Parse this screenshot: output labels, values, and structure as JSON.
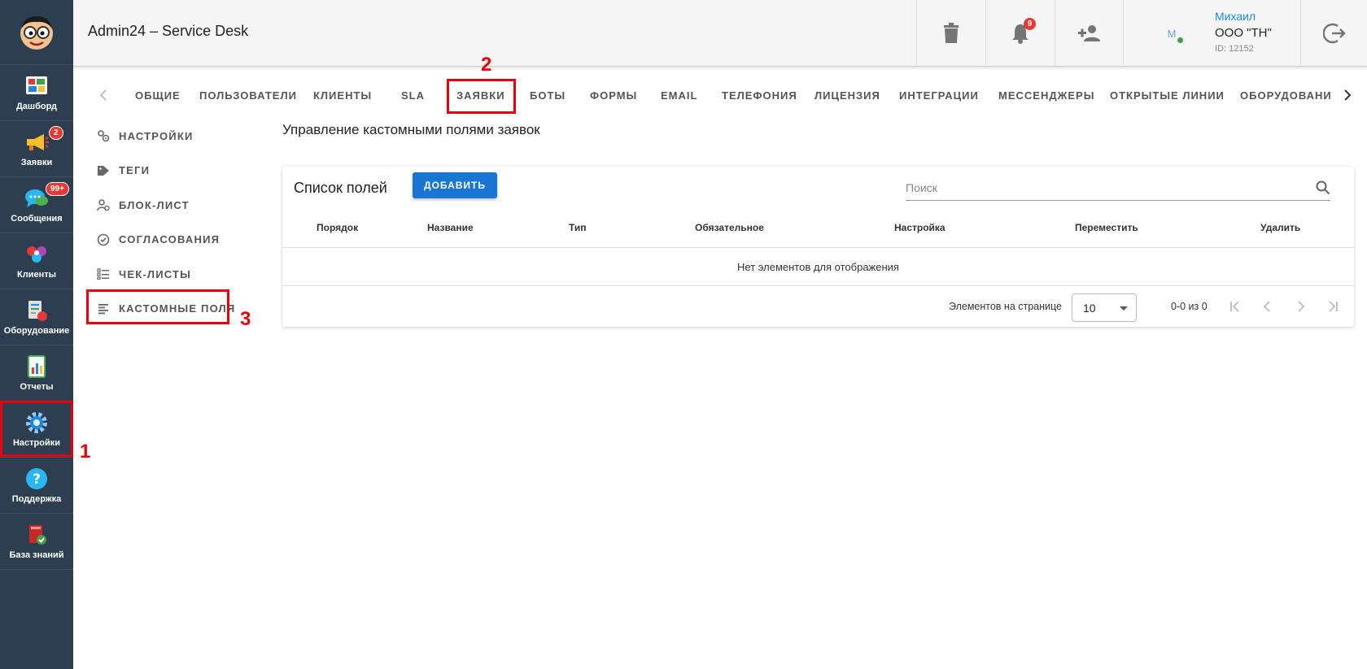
{
  "app": {
    "title": "Admin24 – Service Desk"
  },
  "sidebar": {
    "items": [
      {
        "label": "Дашборд",
        "icon": "dashboard-icon"
      },
      {
        "label": "Заявки",
        "icon": "megaphone-icon",
        "badge": "2"
      },
      {
        "label": "Сообщения",
        "icon": "chat-icon",
        "badge": "99+"
      },
      {
        "label": "Клиенты",
        "icon": "clients-icon"
      },
      {
        "label": "Оборудование",
        "icon": "equipment-icon"
      },
      {
        "label": "Отчеты",
        "icon": "reports-icon"
      },
      {
        "label": "Настройки",
        "icon": "gear-icon"
      },
      {
        "label": "Поддержка",
        "icon": "help-icon"
      },
      {
        "label": "База знаний",
        "icon": "book-icon"
      }
    ]
  },
  "header": {
    "notifications_badge": "9",
    "user": {
      "avatar_letter": "M",
      "name": "Михаил",
      "org": "ООО \"ТН\"",
      "id": "ID: 12152"
    }
  },
  "tabs": [
    "ОБЩИЕ",
    "ПОЛЬЗОВАТЕЛИ",
    "КЛИЕНТЫ",
    "SLA",
    "ЗАЯВКИ",
    "БОТЫ",
    "ФОРМЫ",
    "EMAIL",
    "ТЕЛЕФОНИЯ",
    "ЛИЦЕНЗИЯ",
    "ИНТЕГРАЦИИ",
    "МЕССЕНДЖЕРЫ",
    "ОТКРЫТЫЕ ЛИНИИ",
    "ОБОРУДОВАНИЕ"
  ],
  "side_menu": [
    "НАСТРОЙКИ",
    "ТЕГИ",
    "БЛОК-ЛИСТ",
    "СОГЛАСОВАНИЯ",
    "ЧЕК-ЛИСТЫ",
    "КАСТОМНЫЕ ПОЛЯ"
  ],
  "annotations": {
    "one": "1",
    "two": "2",
    "three": "3"
  },
  "main": {
    "page_title": "Управление кастомными полями заявок",
    "card_title": "Список полей",
    "add_button": "ДОБАВИТЬ",
    "search_placeholder": "Поиск",
    "columns": [
      "Порядок",
      "Название",
      "Тип",
      "Обязательное",
      "Настройка",
      "Переместить",
      "Удалить"
    ],
    "empty_text": "Нет элементов для отображения",
    "pager": {
      "per_page_label": "Элементов на странице",
      "per_page_value": "10",
      "range": "0-0 из 0"
    }
  },
  "colors": {
    "sidebar_bg": "#2d3e50",
    "accent": "#1976d2",
    "badge": "#e53935",
    "annotation": "#e8000b",
    "user_name": "#1e88e5"
  }
}
